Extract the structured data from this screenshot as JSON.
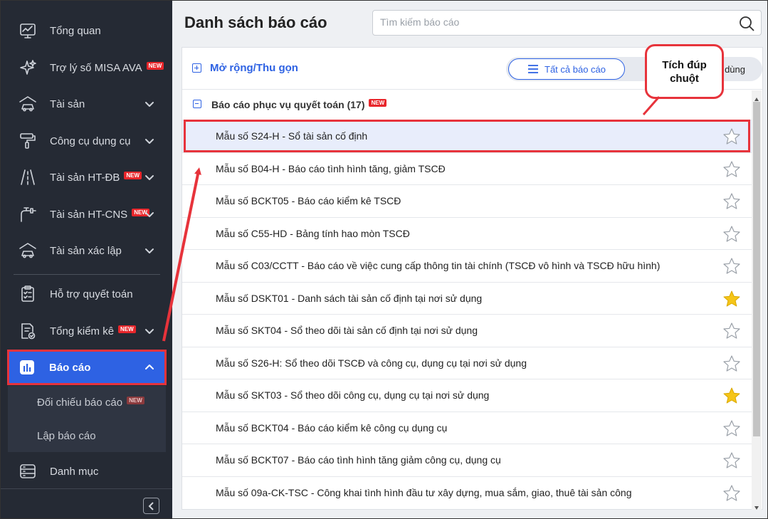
{
  "sidebar": {
    "items": [
      {
        "label": "Tổng quan",
        "icon": "monitor-icon",
        "new": "",
        "chevron": false
      },
      {
        "label": "Trợ lý số MISA AVA",
        "icon": "sparkle-icon",
        "new": "NEW",
        "chevron": false
      },
      {
        "label": "Tài sản",
        "icon": "car-house-icon",
        "new": "",
        "chevron": true
      },
      {
        "label": "Công cụ dụng cụ",
        "icon": "paint-roller-icon",
        "new": "",
        "chevron": true
      },
      {
        "label": "Tài sản HT-ĐB",
        "icon": "road-icon",
        "new": "NEW",
        "chevron": true
      },
      {
        "label": "Tài sản HT-CNS",
        "icon": "water-tap-icon",
        "new": "NEW",
        "chevron": true
      },
      {
        "label": "Tài sản xác lập",
        "icon": "car-house-icon",
        "new": "",
        "chevron": true
      },
      {
        "label": "Hỗ trợ quyết toán",
        "icon": "clipboard-icon",
        "new": "",
        "chevron": false
      },
      {
        "label": "Tổng kiểm kê",
        "icon": "document-check-icon",
        "new": "NEW",
        "chevron": true
      }
    ],
    "active": {
      "label": "Báo cáo",
      "icon": "bar-chart-icon"
    },
    "submenu": [
      {
        "label": "Đối chiếu báo cáo",
        "new": "NEW"
      },
      {
        "label": "Lập báo cáo",
        "new": ""
      }
    ],
    "bottom": {
      "label": "Danh mục",
      "icon": "list-icon"
    }
  },
  "header": {
    "title": "Danh sách báo cáo",
    "search_placeholder": "Tìm kiếm báo cáo"
  },
  "toolbar": {
    "expand_label": "Mở rộng/Thu gọn",
    "tab_all": "Tất cả báo cáo",
    "tab_freq": "g dùng"
  },
  "callout": {
    "text": "Tích đúp\nchuột"
  },
  "group": {
    "title": "Báo cáo phục vụ quyết toán (17)",
    "new": "NEW"
  },
  "reports": [
    {
      "label": "Mẫu số S24-H - Sổ tài sản cố định",
      "starred": false,
      "selected": true
    },
    {
      "label": "Mẫu số B04-H - Báo cáo tình hình tăng, giảm TSCĐ",
      "starred": false,
      "selected": false
    },
    {
      "label": "Mẫu số BCKT05 - Báo cáo kiểm kê TSCĐ",
      "starred": false,
      "selected": false
    },
    {
      "label": "Mẫu số C55-HD - Bảng tính hao mòn TSCĐ",
      "starred": false,
      "selected": false
    },
    {
      "label": "Mẫu số C03/CCTT - Báo cáo về việc cung cấp thông tin tài chính (TSCĐ vô hình và TSCĐ hữu hình)",
      "starred": false,
      "selected": false
    },
    {
      "label": "Mẫu số DSKT01 - Danh sách tài sản cố định tại nơi sử dụng",
      "starred": true,
      "selected": false
    },
    {
      "label": "Mẫu số SKT04 - Sổ theo dõi tài sản cố định tại nơi sử dụng",
      "starred": false,
      "selected": false
    },
    {
      "label": "Mẫu số S26-H: Sổ theo dõi TSCĐ và công cụ, dụng cụ tại nơi sử dụng",
      "starred": false,
      "selected": false
    },
    {
      "label": "Mẫu số SKT03 - Sổ theo dõi công cụ, dụng cụ tại nơi sử dụng",
      "starred": true,
      "selected": false
    },
    {
      "label": "Mẫu số BCKT04 - Báo cáo kiểm kê công cụ dụng cụ",
      "starred": false,
      "selected": false
    },
    {
      "label": "Mẫu số BCKT07 - Báo cáo tình hình tăng giảm công cụ, dụng cụ",
      "starred": false,
      "selected": false
    },
    {
      "label": "Mẫu số 09a-CK-TSC - Công khai tình hình đầu tư xây dựng, mua sắm, giao, thuê tài sản công",
      "starred": false,
      "selected": false
    }
  ],
  "colors": {
    "accent": "#2e62e3",
    "highlight": "#e7333b",
    "sidebar": "#252a34",
    "star": "#f5c518"
  }
}
